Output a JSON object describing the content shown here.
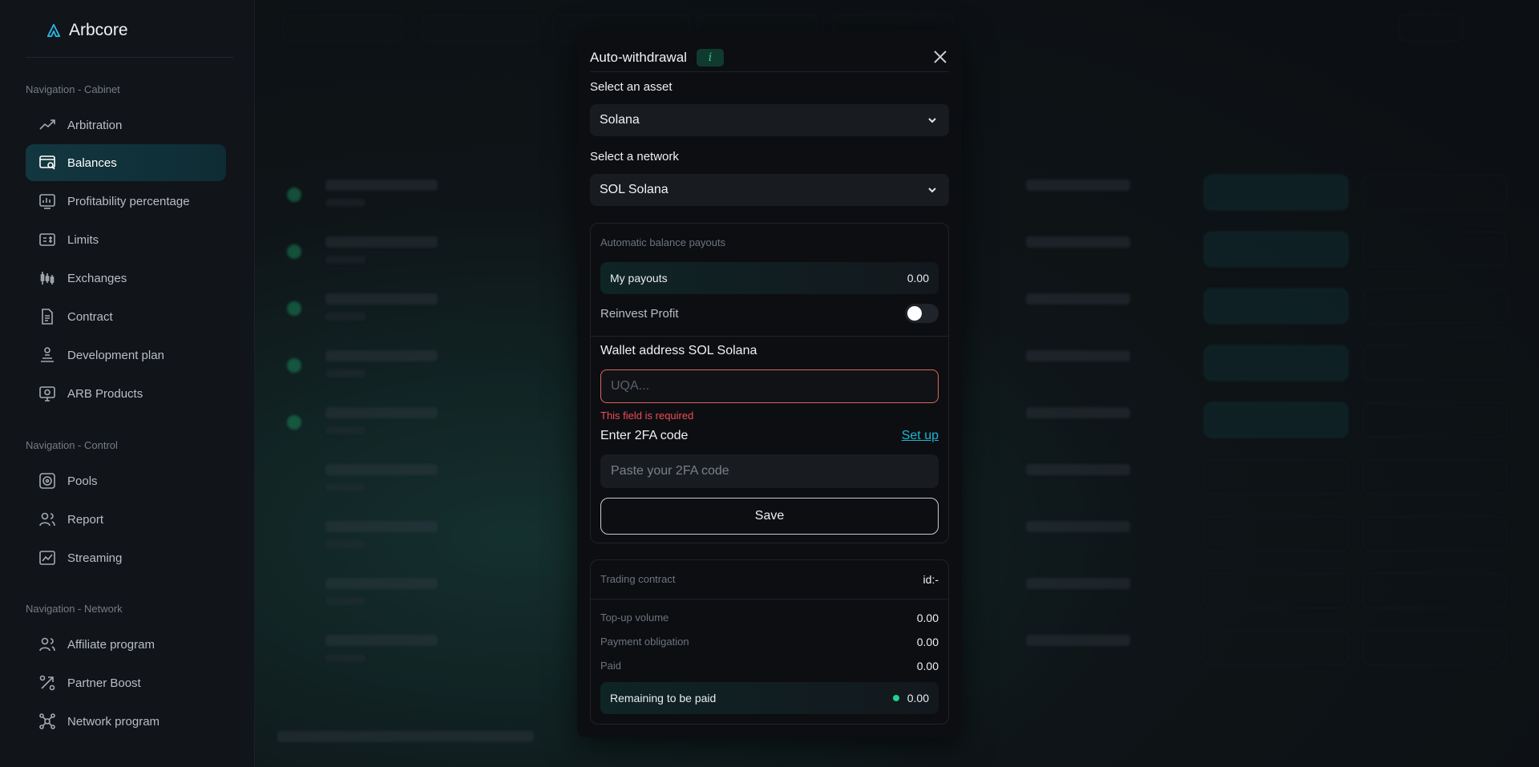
{
  "brand": {
    "name": "Arbcore",
    "accent": "#1fb6d6"
  },
  "sidebar": {
    "sections": [
      {
        "title": "Navigation - Cabinet"
      },
      {
        "title": "Navigation - Control"
      },
      {
        "title": "Navigation - Network"
      }
    ],
    "items": [
      {
        "label": "Arbitration",
        "icon": "trend-up-icon"
      },
      {
        "label": "Balances",
        "icon": "wallet-icon",
        "active": true
      },
      {
        "label": "Profitability percentage",
        "icon": "chart-icon"
      },
      {
        "label": "Limits",
        "icon": "limits-icon"
      },
      {
        "label": "Exchanges",
        "icon": "candles-icon"
      },
      {
        "label": "Contract",
        "icon": "document-icon"
      },
      {
        "label": "Development plan",
        "icon": "plan-icon"
      },
      {
        "label": "ARB Products",
        "icon": "monitor-icon"
      },
      {
        "label": "Pools",
        "icon": "pools-icon"
      },
      {
        "label": "Report",
        "icon": "users-icon"
      },
      {
        "label": "Streaming",
        "icon": "stream-icon"
      },
      {
        "label": "Affiliate program",
        "icon": "affiliate-icon"
      },
      {
        "label": "Partner Boost",
        "icon": "boost-icon"
      },
      {
        "label": "Network program",
        "icon": "network-icon"
      }
    ]
  },
  "modal": {
    "title": "Auto-withdrawal",
    "info_badge": "i",
    "asset_label": "Select an asset",
    "asset_value": "Solana",
    "network_label": "Select a network",
    "network_value": "SOL Solana",
    "payouts_section": {
      "title": "Automatic balance payouts",
      "my_payouts_label": "My payouts",
      "my_payouts_value": "0.00",
      "reinvest_label": "Reinvest Profit",
      "reinvest_enabled": false
    },
    "wallet_label": "Wallet address SOL Solana",
    "wallet_placeholder": "UQA...",
    "wallet_error": "This field is required",
    "twofa_label": "Enter 2FA code",
    "setup_link": "Set up",
    "twofa_placeholder": "Paste your 2FA code",
    "save_label": "Save",
    "contract": {
      "title": "Trading contract",
      "id_value": "id:-",
      "rows": [
        {
          "label": "Top-up volume",
          "value": "0.00"
        },
        {
          "label": "Payment obligation",
          "value": "0.00"
        },
        {
          "label": "Paid",
          "value": "0.00"
        }
      ],
      "remaining_label": "Remaining to be paid",
      "remaining_value": "0.00"
    }
  }
}
